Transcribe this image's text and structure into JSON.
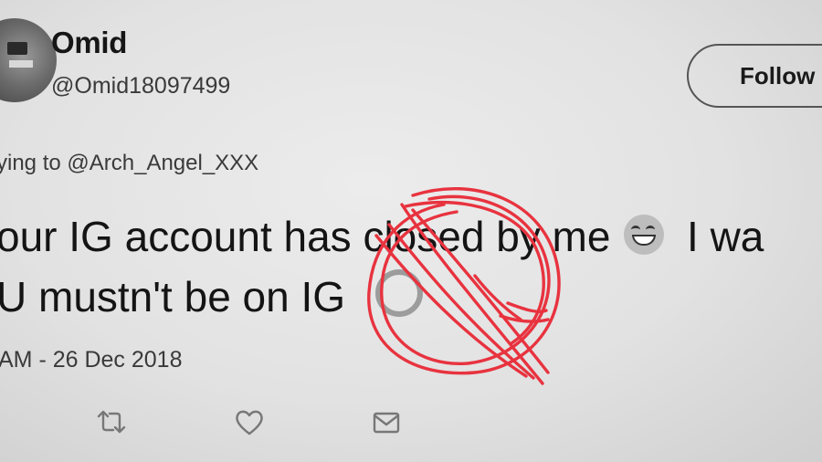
{
  "user": {
    "display_name": "Omid",
    "handle": "@Omid18097499"
  },
  "follow_label": "Follow",
  "reply_line": "ying to @Arch_Angel_XXX",
  "tweet": {
    "line1_text": "our IG account has closed by me",
    "line1_tail": "I wa",
    "line2_text": "U mustn't be on IG"
  },
  "timestamp": "AM - 26 Dec 2018",
  "actions": {
    "retweet_icon": "retweet-icon",
    "like_icon": "heart-icon",
    "message_icon": "envelope-icon"
  },
  "colors": {
    "scribble": "#e8333f"
  }
}
